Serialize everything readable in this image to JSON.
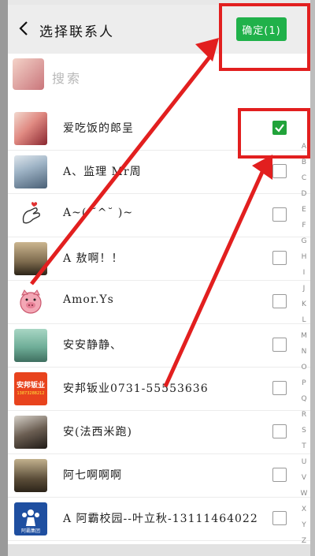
{
  "header": {
    "title": "选择联系人",
    "confirm_label": "确定(1)"
  },
  "search": {
    "placeholder": "搜索"
  },
  "contacts": [
    {
      "name": "爱吃饭的郎呈",
      "checked": true
    },
    {
      "name": "A、监理 Mr周",
      "checked": false
    },
    {
      "name": "A~( ˘^˘ )~",
      "checked": false
    },
    {
      "name": "A     敖啊！！",
      "checked": false
    },
    {
      "name": "Amor.Ys",
      "checked": false
    },
    {
      "name": "安安静静、",
      "checked": false
    },
    {
      "name": "安邦钣业0731-55553636",
      "checked": false
    },
    {
      "name": "安(法西米跑)",
      "checked": false
    },
    {
      "name": "阿七啊啊啊",
      "checked": false
    },
    {
      "name": "A 阿霸校园--叶立秋-13111464022",
      "checked": false
    }
  ],
  "avatar_texts": {
    "anbang": "安邦钣业",
    "anbang_phone": "13873288212",
    "aba": "阿霸集团"
  },
  "index_letters": [
    "A",
    "B",
    "C",
    "D",
    "E",
    "F",
    "G",
    "H",
    "I",
    "J",
    "K",
    "L",
    "M",
    "N",
    "O",
    "P",
    "Q",
    "R",
    "S",
    "T",
    "U",
    "V",
    "W",
    "X",
    "Y",
    "Z",
    "#"
  ],
  "colors": {
    "accent_green": "#20b14a",
    "highlight_red": "#e21f1f"
  }
}
